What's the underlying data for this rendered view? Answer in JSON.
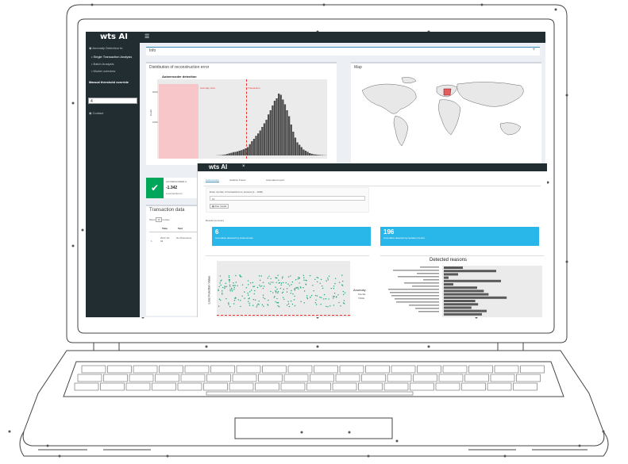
{
  "app": {
    "brand": "wts AI",
    "menu_icon": "hamburger-icon"
  },
  "sidebar": {
    "items": [
      {
        "label": "Anomaly Detection fo",
        "icon": "circle-icon"
      },
      {
        "label": "Single Transaction Analysis",
        "icon": "bullet-icon"
      },
      {
        "label": "Batch Analysis",
        "icon": "bullet-icon"
      },
      {
        "label": "Model overview",
        "icon": "bullet-icon"
      }
    ],
    "threshold_label": "Manual threshold override",
    "threshold_value": "4",
    "contact_label": "Contact"
  },
  "info_bar": {
    "label": "Info",
    "toggle": "+"
  },
  "histogram_box": {
    "title": "Distribution of reconstruction error",
    "chart_title": "Autoencoder detection",
    "ylabel": "Count",
    "anomaly_zone_label": "Anomaly zone",
    "transaction_label": "Transaction",
    "ytick_top": "2000",
    "ytick_mid": "1000"
  },
  "map_box": {
    "title": "Map"
  },
  "result_box": {
    "icon": "check-icon",
    "line1": "AUTOENCODER A",
    "line2": "-1.342",
    "line3": "Loss function is"
  },
  "transaction_box": {
    "title": "Transaction data",
    "show_label": "Show",
    "show_value": "10",
    "entries_label": "entries",
    "columns": [
      "Time",
      "Text"
    ],
    "row": {
      "index": "1",
      "time": "2017-10-02",
      "text": "No Preference"
    }
  },
  "window2": {
    "brand": "wts AI",
    "close": "×",
    "tabs": [
      "Autoencoder",
      "Isolation Forest",
      "Automated report"
    ],
    "prompt": "Enter number of transactions to process (1 - 1000)",
    "input_value": "10",
    "run_button": "Run model",
    "summary_label": "Results summary",
    "stat1": {
      "value": "6",
      "label": "Anomalies detected by Autoencoder"
    },
    "stat2": {
      "value": "196",
      "label": "Anomalies detected by Isolation Forest"
    },
    "scatter_ylabel": "Loss Function Value",
    "legend_title": "Anomaly",
    "legend_items": [
      "FALSE",
      "TRUE"
    ],
    "reasons_title": "Detected reasons",
    "accent": "#29b6e8"
  },
  "chart_data": [
    {
      "type": "bar",
      "title": "Autoencoder detection",
      "ylabel": "Count",
      "values": [
        1,
        2,
        3,
        5,
        8,
        12,
        18,
        22,
        28,
        30,
        34,
        40,
        45,
        52,
        60,
        70,
        95,
        120,
        140,
        165,
        185,
        210,
        240,
        270,
        300,
        345,
        380,
        420,
        460,
        480,
        520,
        510,
        470,
        430,
        380,
        330,
        260,
        200,
        150,
        110,
        90,
        70,
        50,
        40,
        30,
        20,
        14,
        10,
        8,
        6,
        4,
        3,
        2,
        1
      ]
    },
    {
      "type": "bar",
      "title": "Detected reasons",
      "values": [
        0.2,
        0.55,
        0.15,
        0.05,
        0.6,
        0.1,
        0.35,
        0.42,
        0.47,
        0.66,
        0.33,
        0.36,
        0.29,
        0.45,
        0.4
      ]
    }
  ]
}
